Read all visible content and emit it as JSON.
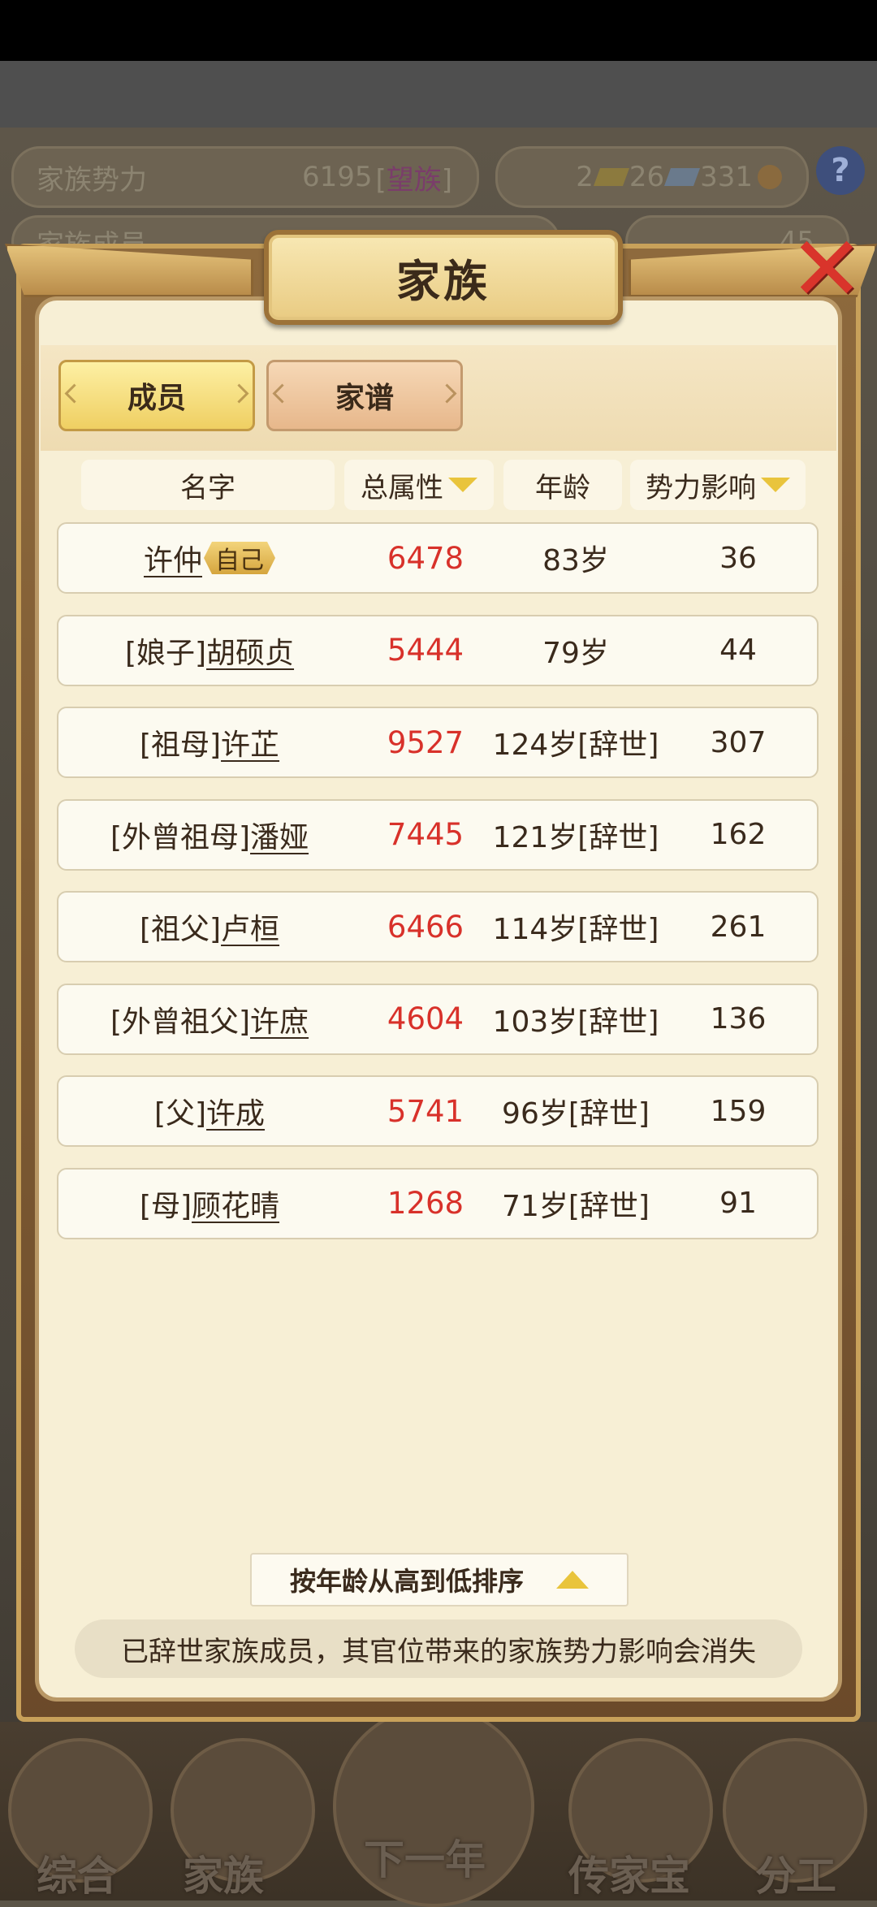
{
  "background": {
    "power_label": "家族势力",
    "power_value": "6195",
    "power_rank": "望族",
    "currency_1": "2",
    "currency_2": "26",
    "currency_3": "331",
    "help_label": "?",
    "members_label": "家族成员",
    "members_count": "45",
    "nav": [
      "综合",
      "家族",
      "下一年",
      "传家宝",
      "分工"
    ]
  },
  "modal": {
    "title": "家族",
    "close_label": "✕"
  },
  "tabs": [
    {
      "label": "成员",
      "active": true
    },
    {
      "label": "家谱",
      "active": false
    }
  ],
  "columns": {
    "name": "名字",
    "attribute": "总属性",
    "age": "年龄",
    "influence": "势力影响"
  },
  "members": [
    {
      "prefix": "",
      "name": "许仲",
      "tag": "自己",
      "attribute": "6478",
      "age": "83岁",
      "influence": "36"
    },
    {
      "prefix": "[娘子]",
      "name": "胡硕贞",
      "tag": "",
      "attribute": "5444",
      "age": "79岁",
      "influence": "44"
    },
    {
      "prefix": "[祖母]",
      "name": "许芷",
      "tag": "",
      "attribute": "9527",
      "age": "124岁[辞世]",
      "influence": "307"
    },
    {
      "prefix": "[外曾祖母]",
      "name": "潘娅",
      "tag": "",
      "attribute": "7445",
      "age": "121岁[辞世]",
      "influence": "162"
    },
    {
      "prefix": "[祖父]",
      "name": "卢桓",
      "tag": "",
      "attribute": "6466",
      "age": "114岁[辞世]",
      "influence": "261"
    },
    {
      "prefix": "[外曾祖父]",
      "name": "许庶",
      "tag": "",
      "attribute": "4604",
      "age": "103岁[辞世]",
      "influence": "136"
    },
    {
      "prefix": "[父]",
      "name": "许成",
      "tag": "",
      "attribute": "5741",
      "age": "96岁[辞世]",
      "influence": "159"
    },
    {
      "prefix": "[母]",
      "name": "顾花晴",
      "tag": "",
      "attribute": "1268",
      "age": "71岁[辞世]",
      "influence": "91"
    }
  ],
  "sort_label": "按年龄从高到低排序",
  "notice": "已辞世家族成员，其官位带来的家族势力影响会消失",
  "colors": {
    "attribute_red": "#d8312a",
    "close_red": "#d9342b",
    "gold": "#e9c43c"
  }
}
